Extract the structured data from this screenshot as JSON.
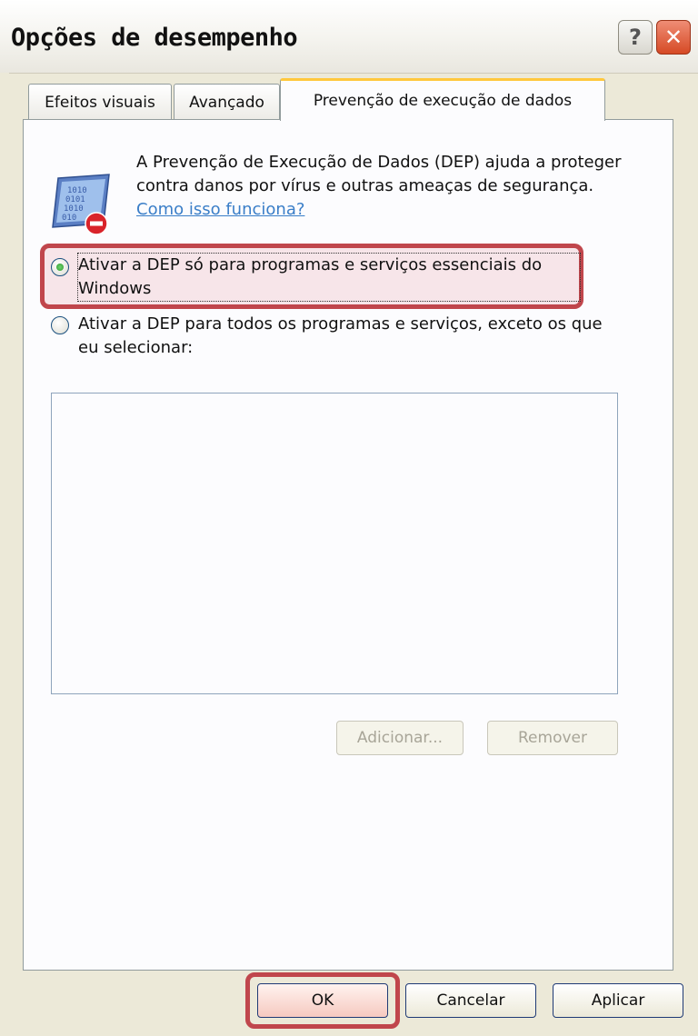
{
  "window": {
    "title": "Opções de desempenho",
    "help_glyph": "?",
    "close_glyph": "✕"
  },
  "tabs": [
    {
      "label": "Efeitos visuais",
      "active": false
    },
    {
      "label": "Avançado",
      "active": false
    },
    {
      "label": "Prevenção de execução de dados",
      "active": true
    }
  ],
  "panel": {
    "icon": "dep-shield-icon",
    "description": "A Prevenção de Execução de Dados (DEP) ajuda a proteger contra danos por vírus e outras ameaças de segurança. ",
    "link": "Como isso funciona?"
  },
  "options": [
    {
      "label": "Ativar a DEP só para programas e serviços essenciais do Windows",
      "selected": true,
      "highlighted": true
    },
    {
      "label": "Ativar a DEP para todos os programas e serviços, exceto os que eu selecionar:",
      "selected": false,
      "highlighted": false
    }
  ],
  "list_buttons": {
    "add": "Adicionar...",
    "remove": "Remover"
  },
  "dialog_buttons": {
    "ok": "OK",
    "cancel": "Cancelar",
    "apply": "Aplicar"
  },
  "colors": {
    "highlight_border": "#c0464c",
    "active_tab_accent": "#ffc83c",
    "link": "#3a7ec8"
  }
}
